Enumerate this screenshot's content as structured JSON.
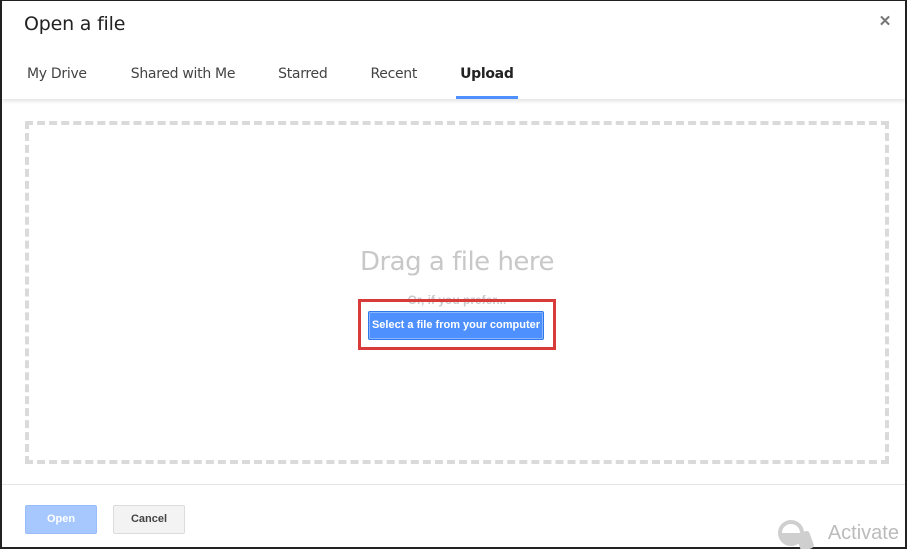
{
  "dialog": {
    "title": "Open a file",
    "close_icon": "close-icon"
  },
  "tabs": [
    {
      "label": "My Drive",
      "active": false
    },
    {
      "label": "Shared with Me",
      "active": false
    },
    {
      "label": "Starred",
      "active": false
    },
    {
      "label": "Recent",
      "active": false
    },
    {
      "label": "Upload",
      "active": true
    }
  ],
  "upload": {
    "drag_text": "Drag a file here",
    "prefer_text": "Or, if you prefer...",
    "select_button": "Select a file from your computer"
  },
  "footer": {
    "open_label": "Open",
    "cancel_label": "Cancel"
  },
  "watermark": {
    "text": "Activate",
    "icon": "key-icon"
  },
  "colors": {
    "accent": "#4d90fe",
    "highlight": "#d93a3a",
    "disabled_button": "#a6c8ff"
  }
}
